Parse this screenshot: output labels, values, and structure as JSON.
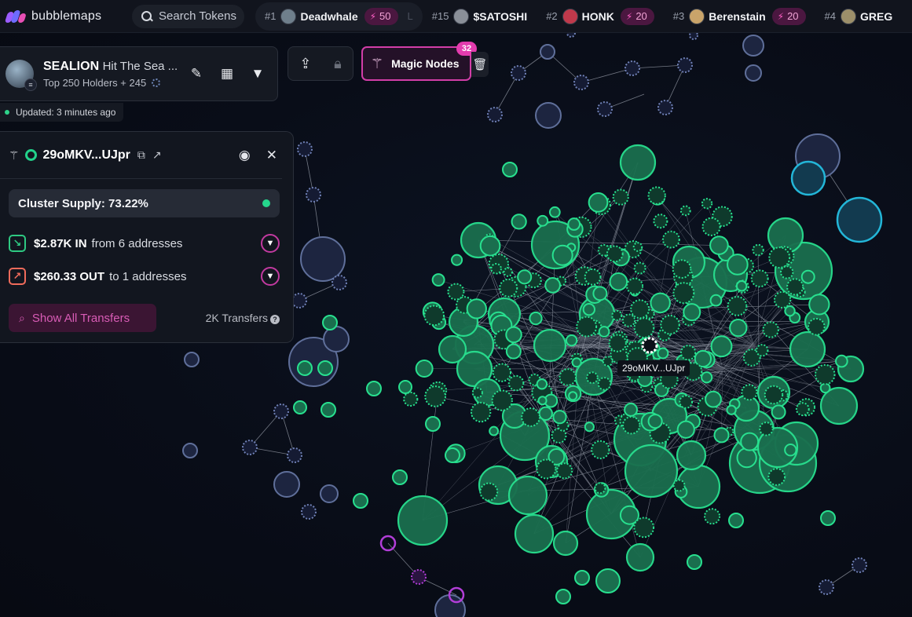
{
  "brand": {
    "name": "bubblemaps"
  },
  "search": {
    "placeholder": "Search Tokens"
  },
  "trending": [
    {
      "rank": "#1",
      "name": "Deadwhale",
      "boost": "50",
      "featured": true,
      "avatar_color": "#6f7f8c",
      "ghost": "L"
    },
    {
      "rank": "#15",
      "name": "$SATOSHI",
      "boost": "",
      "featured": false,
      "avatar_color": "#8a8f98"
    },
    {
      "rank": "#2",
      "name": "HONK",
      "boost": "20",
      "featured": false,
      "avatar_color": "#c0394b"
    },
    {
      "rank": "#3",
      "name": "Berenstain",
      "boost": "20",
      "featured": false,
      "avatar_color": "#c9a46a"
    },
    {
      "rank": "#4",
      "name": "GREG",
      "boost": "",
      "featured": false,
      "avatar_color": "#9c8f6a"
    }
  ],
  "token": {
    "symbol": "SEALION",
    "name": "Hit The Sea ...",
    "holders_text": "Top 250 Holders + 245",
    "updated": "Updated: 3 minutes ago"
  },
  "toolbar": {
    "magic_label": "Magic Nodes",
    "magic_count": "32"
  },
  "wallet": {
    "address": "29oMKV...UJpr",
    "cluster_supply": "Cluster Supply: 73.22%",
    "in_amount": "$2.87K IN",
    "in_rest": "from 6 addresses",
    "out_amount": "$260.33 OUT",
    "out_rest": "to 1 addresses",
    "show_all": "Show All Transfers",
    "transfers_count": "2K Transfers"
  },
  "graph": {
    "selected_label": "29oMKV...UJpr",
    "colors": {
      "green_fill": "#1a6e4e",
      "green_stroke": "#28e08f",
      "dark_fill": "#1d2540",
      "dark_stroke": "#5f6f9a",
      "cyan_stroke": "#23b6d8",
      "purple_stroke": "#b23ed8",
      "edge": "#c9cfdb"
    }
  }
}
